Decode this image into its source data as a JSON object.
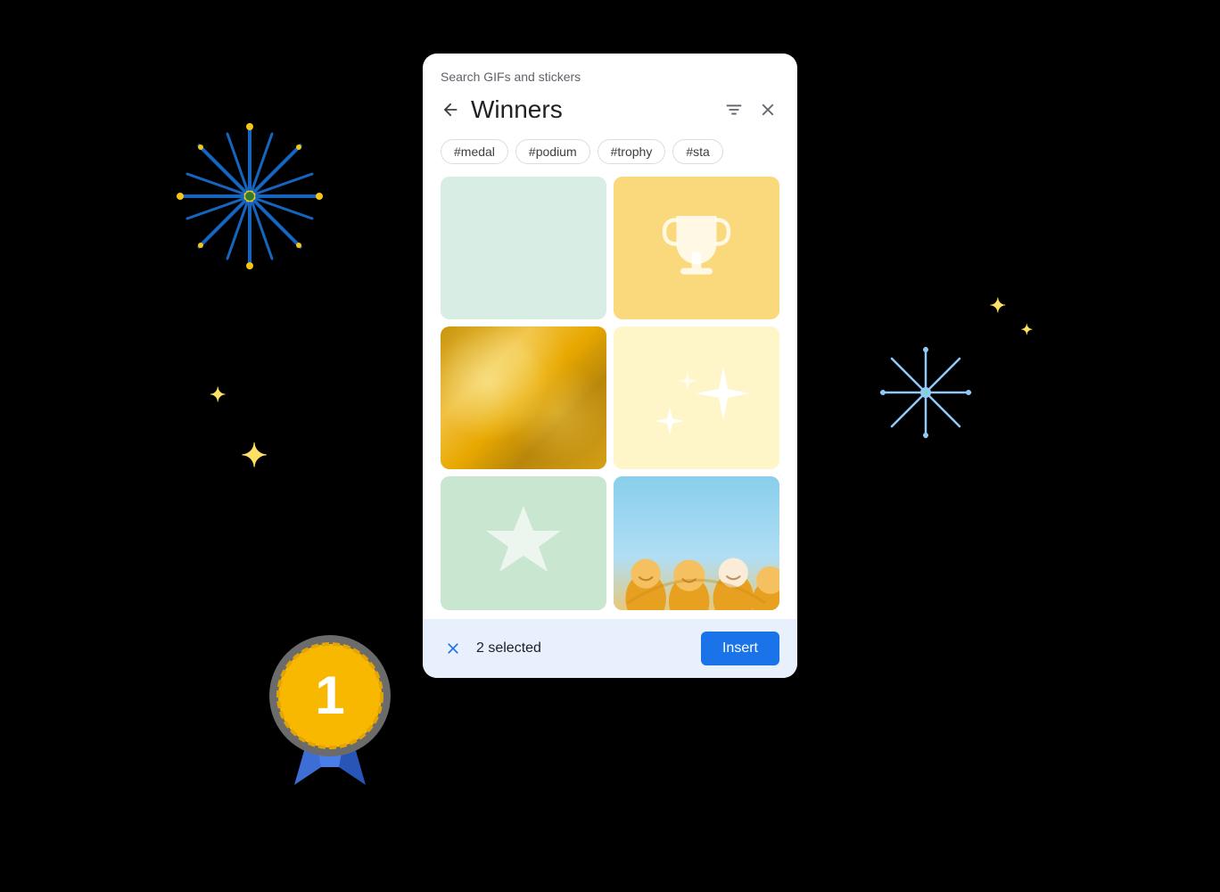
{
  "background": {
    "color": "#000000"
  },
  "dialog": {
    "header_label": "Search GIFs and stickers",
    "back_button_label": "←",
    "title": "Winners",
    "filter_button_label": "filter",
    "close_button_label": "×",
    "tags": [
      "#medal",
      "#podium",
      "#trophy",
      "#sta"
    ],
    "grid_items": [
      {
        "id": 1,
        "type": "plain",
        "bg": "#d8ede3"
      },
      {
        "id": 2,
        "type": "trophy",
        "bg": "#f9d97b"
      },
      {
        "id": 3,
        "type": "bokeh",
        "bg": "#c8960c"
      },
      {
        "id": 4,
        "type": "sparkles",
        "bg": "#fef6c8"
      },
      {
        "id": 5,
        "type": "star",
        "bg": "#c8e6d0"
      },
      {
        "id": 6,
        "type": "people",
        "bg": "#87ceeb"
      }
    ],
    "footer": {
      "selected_count": "2 selected",
      "insert_label": "Insert",
      "clear_icon": "×"
    }
  }
}
